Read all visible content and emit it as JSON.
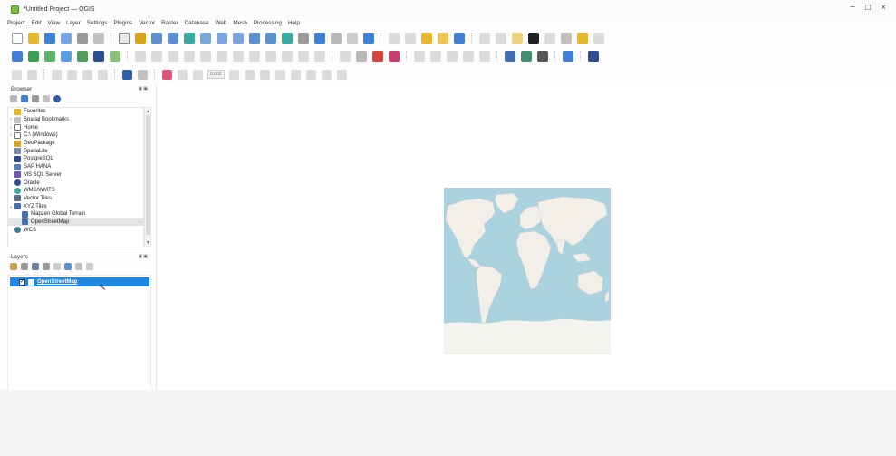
{
  "window": {
    "title": "*Untitled Project — QGIS",
    "minimize_glyph": "−",
    "maximize_glyph": "□",
    "close_glyph": "×"
  },
  "menu": [
    "Project",
    "Edit",
    "View",
    "Layer",
    "Settings",
    "Plugins",
    "Vector",
    "Raster",
    "Database",
    "Web",
    "Mesh",
    "Processing",
    "Help"
  ],
  "browser": {
    "title": "Browser",
    "panel_controls": "▣▣",
    "items": [
      {
        "label": "Favorites",
        "icon": "star-icon",
        "expander": ""
      },
      {
        "label": "Spatial Bookmarks",
        "icon": "bookmark-icon",
        "expander": "›"
      },
      {
        "label": "Home",
        "icon": "home-folder-icon",
        "expander": "›"
      },
      {
        "label": "C:\\ (Windows)",
        "icon": "drive-icon",
        "expander": "›"
      },
      {
        "label": "GeoPackage",
        "icon": "geopackage-icon",
        "expander": ""
      },
      {
        "label": "SpatiaLite",
        "icon": "spatialite-icon",
        "expander": ""
      },
      {
        "label": "PostgreSQL",
        "icon": "postgresql-icon",
        "expander": ""
      },
      {
        "label": "SAP HANA",
        "icon": "sap-hana-icon",
        "expander": ""
      },
      {
        "label": "MS SQL Server",
        "icon": "mssql-icon",
        "expander": ""
      },
      {
        "label": "Oracle",
        "icon": "oracle-icon",
        "expander": ""
      },
      {
        "label": "WMS/WMTS",
        "icon": "wms-icon",
        "expander": ""
      },
      {
        "label": "Vector Tiles",
        "icon": "vector-tiles-icon",
        "expander": ""
      },
      {
        "label": "XYZ Tiles",
        "icon": "xyz-tiles-icon",
        "expander": "⌄"
      },
      {
        "label": "Mapzen Global Terrain",
        "icon": "tile-grid-icon",
        "expander": ""
      },
      {
        "label": "OpenStreetMap",
        "icon": "tile-grid-icon",
        "expander": ""
      },
      {
        "label": "WCS",
        "icon": "wcs-icon",
        "expander": ""
      }
    ],
    "scroll_up": "▲",
    "scroll_down": "▼"
  },
  "layers": {
    "title": "Layers",
    "panel_controls": "▣▣",
    "items": [
      {
        "label": "OpenStreetMap",
        "checked": true,
        "check_glyph": "✓"
      }
    ]
  },
  "map": {
    "ocean_color": "#aad3df",
    "land_color": "#f2efe9",
    "antarctica_color": "#f5f3ef"
  },
  "toolbar3": {
    "field_value": "0.000"
  },
  "accent_color": "#1e88e5"
}
